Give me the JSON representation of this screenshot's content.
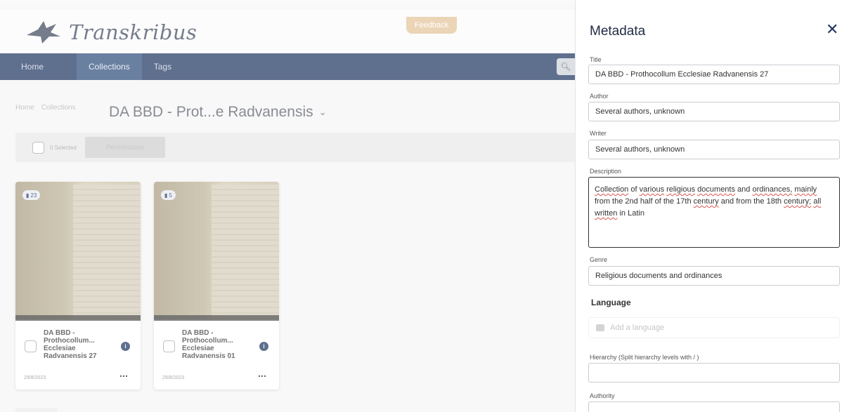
{
  "app": {
    "brand": "Transkribus",
    "feedback_label": "Feedback",
    "nav": {
      "home": "Home",
      "collections": "Collections",
      "tags": "Tags"
    },
    "search_icon": "search-icon",
    "breadcrumb": {
      "home": "Home",
      "collections": "Collections"
    },
    "collection_title": "DA BBD - Prot...e Radvanensis",
    "toolbar": {
      "selected": "0 Selected",
      "permissions": "Permissions"
    },
    "cards": [
      {
        "badge": "23",
        "title": "DA BBD - Prothocollum... Ecclesiae Radvanensis 27",
        "date": "29/8/2023"
      },
      {
        "badge": "5",
        "title": "DA BBD - Prothocollum... Ecclesiae Radvanensis 01",
        "date": "29/8/2023"
      }
    ]
  },
  "metadata": {
    "heading": "Metadata",
    "close_icon": "close-icon",
    "title_label": "Title",
    "title_value": "DA BBD - Prothocollum Ecclesiae Radvanensis 27",
    "author_label": "Author",
    "author_value": "Several authors, unknown",
    "writer_label": "Writer",
    "writer_value": "Several authors, unknown",
    "description_label": "Description",
    "description_parts": {
      "p1": "Collection",
      "p2": " of ",
      "p3": "various",
      "p4": " ",
      "p5": "religious",
      "p6": " ",
      "p7": "documents",
      "p8": " and ",
      "p9": "ordinances,",
      "p10": " ",
      "p11": "mainly",
      "p12": " from the 2nd half of the 17th ",
      "p13": "century",
      "p14": " and from the 18th ",
      "p15": "century;",
      "p16": " ",
      "p17": "all",
      "p18": " ",
      "p19": "written",
      "p20": " in Latin"
    },
    "genre_label": "Genre",
    "genre_value": "Religious  documents and ordinances",
    "language_heading": "Language",
    "language_placeholder": "Add a language",
    "hierarchy_label": "Hierarchy (Split hierarchy levels with / )",
    "hierarchy_value": "",
    "authority_label": "Authority"
  }
}
